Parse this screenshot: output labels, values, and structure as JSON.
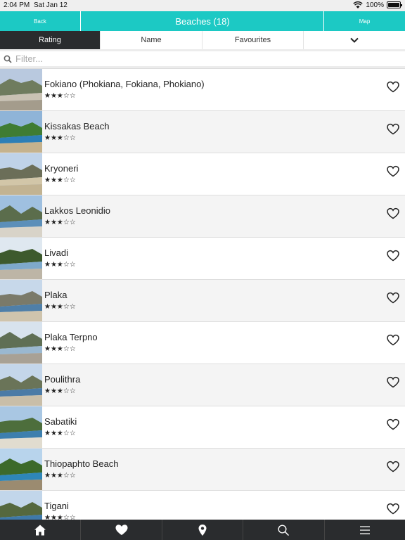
{
  "status": {
    "time": "2:04 PM",
    "date": "Sat Jan 12",
    "battery": "100%"
  },
  "nav": {
    "back_label": "Back",
    "title": "Beaches (18)",
    "map_label": "Map"
  },
  "tabs": {
    "rating": "Rating",
    "name": "Name",
    "favourites": "Favourites"
  },
  "filter": {
    "placeholder": "Filter..."
  },
  "stars": "★★★☆☆",
  "beaches": [
    {
      "name": "Fokiano (Phokiana, Fokiana, Phokiano)",
      "rating": 3
    },
    {
      "name": "Kissakas Beach",
      "rating": 3
    },
    {
      "name": "Kryoneri",
      "rating": 3
    },
    {
      "name": "Lakkos Leonidio",
      "rating": 3
    },
    {
      "name": "Livadi",
      "rating": 3
    },
    {
      "name": "Plaka",
      "rating": 3
    },
    {
      "name": "Plaka Terpno",
      "rating": 3
    },
    {
      "name": "Poulithra",
      "rating": 3
    },
    {
      "name": "Sabatiki",
      "rating": 3
    },
    {
      "name": "Thiopaphto Beach",
      "rating": 3
    },
    {
      "name": "Tigani",
      "rating": 3
    }
  ],
  "bottom_tabs": [
    "home-icon",
    "heart-icon",
    "map-pin-icon",
    "search-icon",
    "menu-icon"
  ],
  "colors": {
    "accent": "#1cc9c4",
    "dark": "#2a2c2e"
  }
}
